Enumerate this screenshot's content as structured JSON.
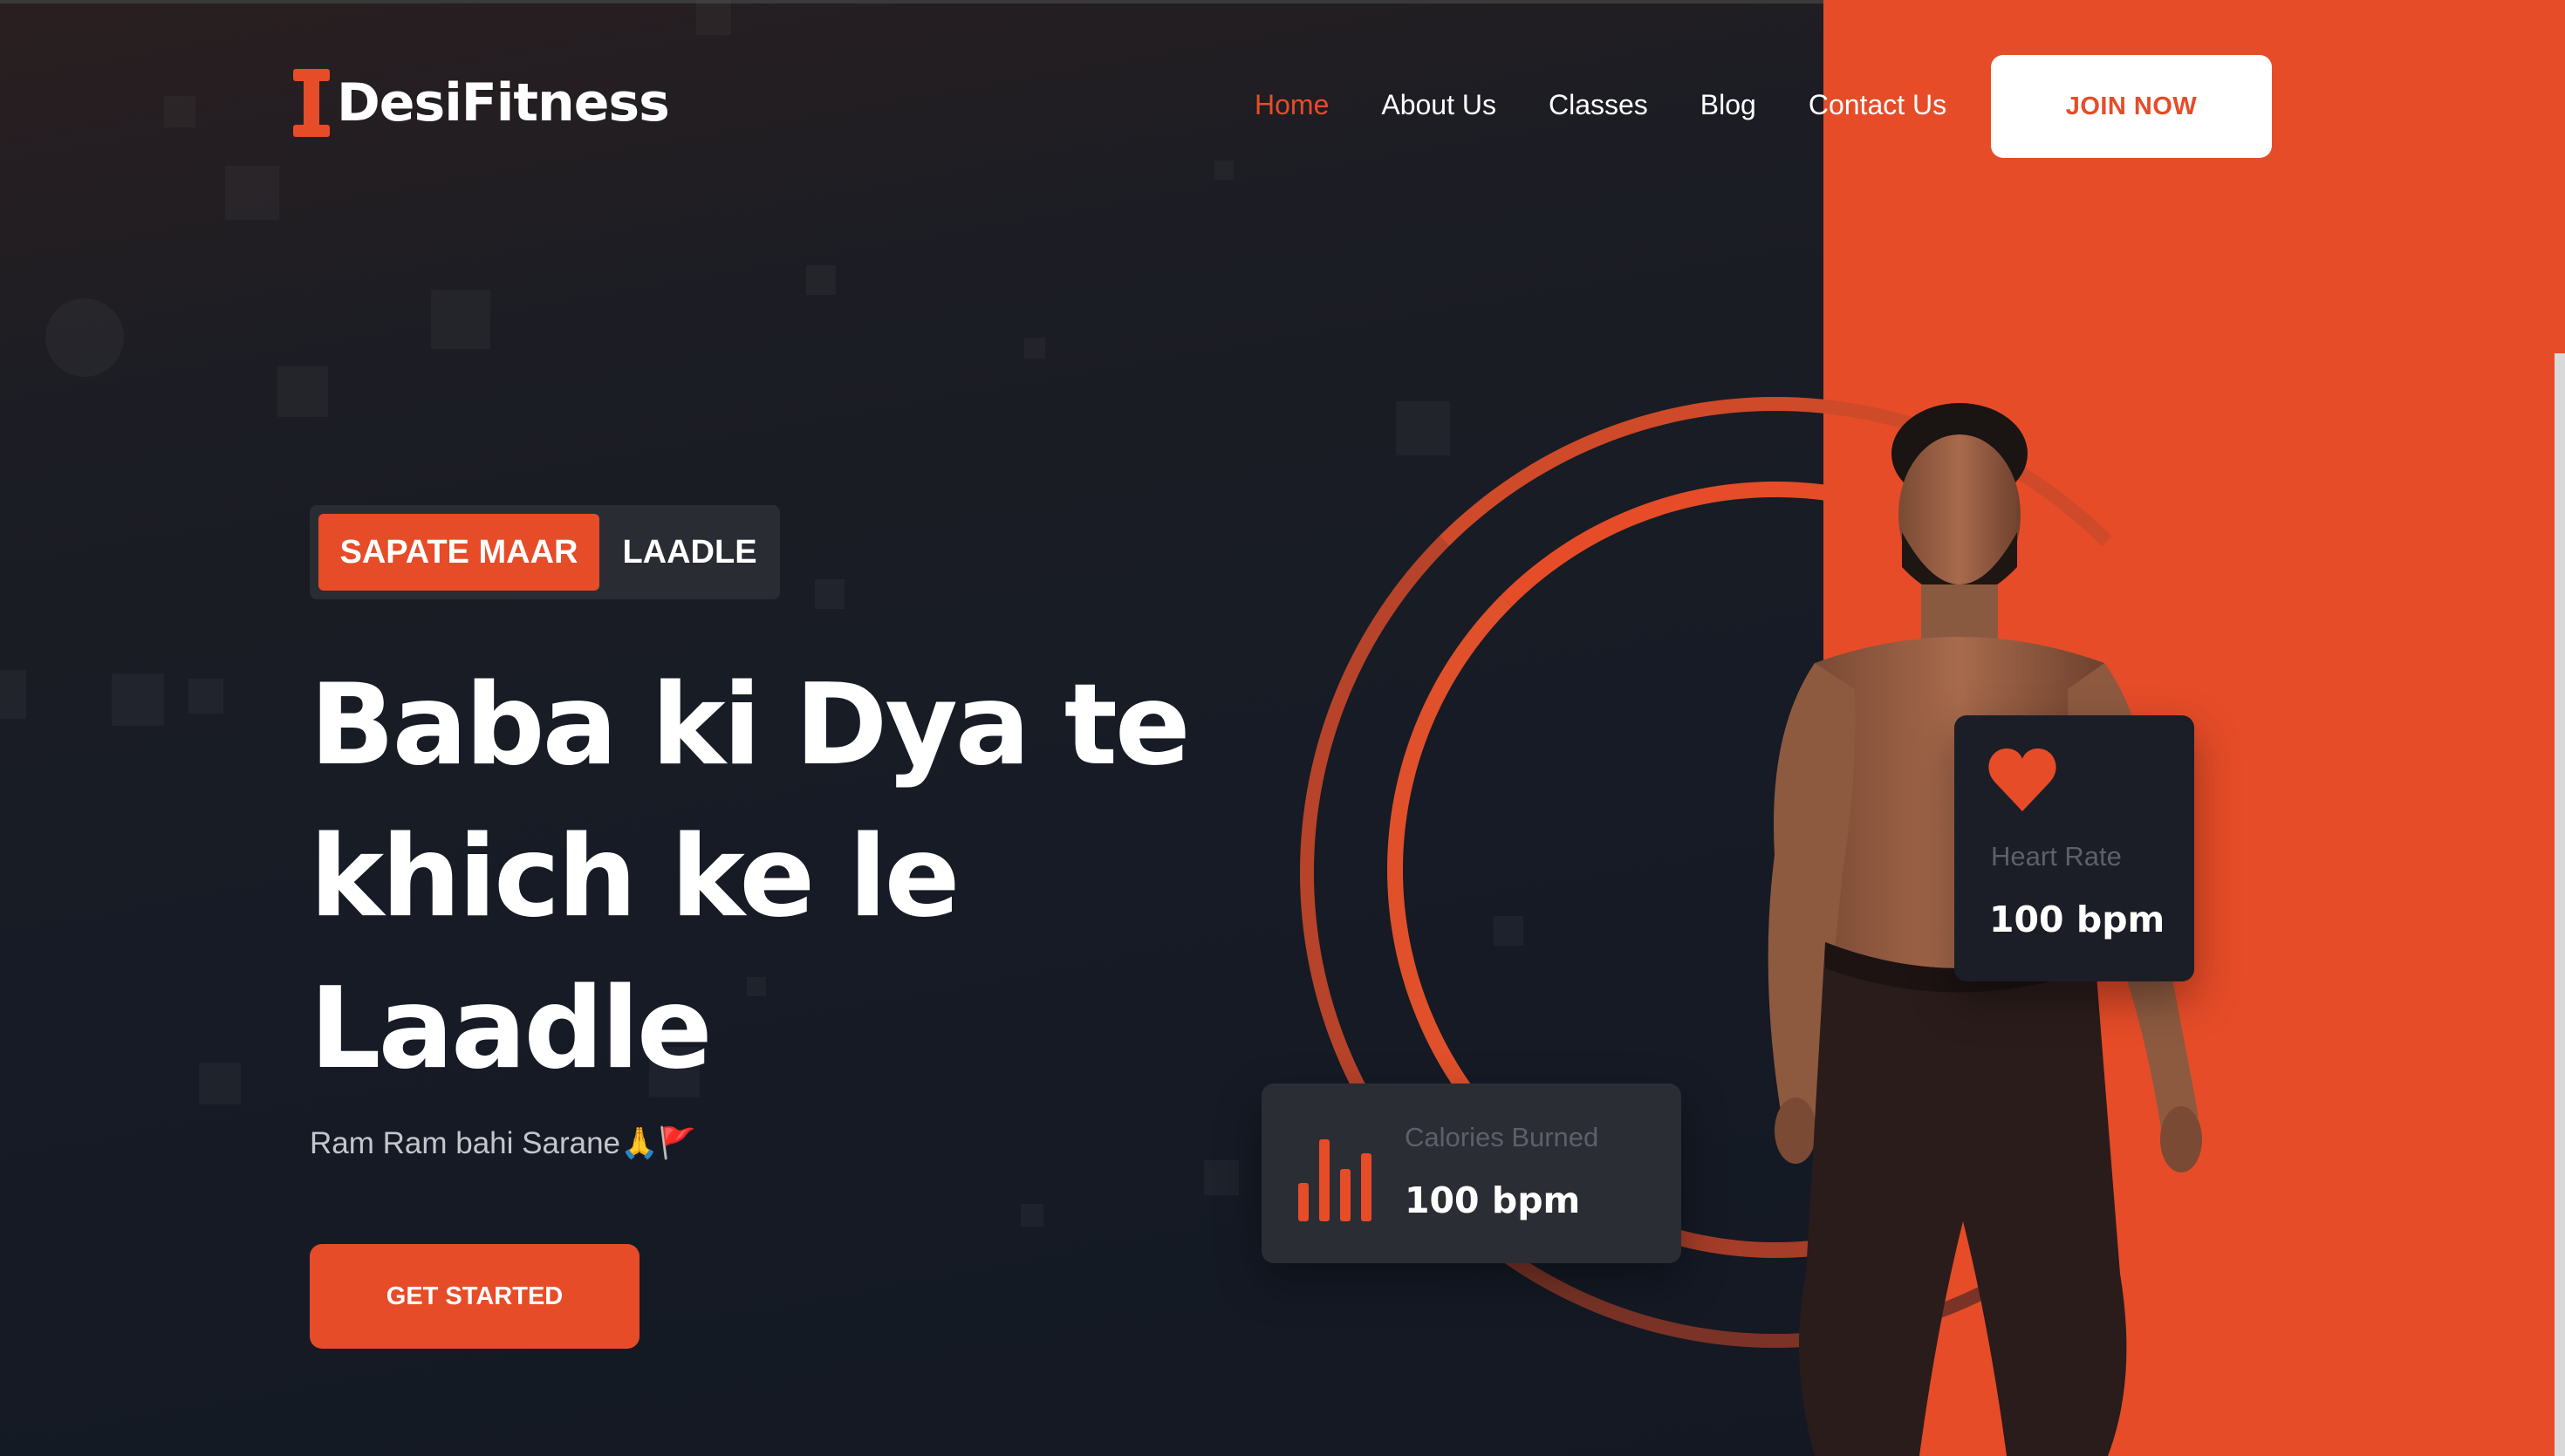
{
  "brand": {
    "name": "DesiFitness",
    "accent": "#e64c28"
  },
  "nav": {
    "items": [
      {
        "label": "Home",
        "active": true
      },
      {
        "label": "About Us",
        "active": false
      },
      {
        "label": "Classes",
        "active": false
      },
      {
        "label": "Blog",
        "active": false
      },
      {
        "label": "Contact Us",
        "active": false
      }
    ],
    "cta": "JOIN NOW"
  },
  "hero": {
    "tag_primary": "SAPATE MAAR",
    "tag_secondary": "LAADLE",
    "title_line1": "Baba ki Dya te",
    "title_line2": "khich ke le",
    "title_line3": "Laadle",
    "subtitle": "Ram Ram bahi Sarane🙏🚩",
    "button": "GET STARTED"
  },
  "stats": {
    "heart": {
      "label": "Heart Rate",
      "value": "100 bpm",
      "icon": "heart-icon"
    },
    "calories": {
      "label": "Calories Burned",
      "value": "100 bpm",
      "icon": "bar-chart-icon"
    }
  },
  "colors": {
    "background": "#161b24",
    "panel": "#e64c28",
    "card": "#1b1e26"
  }
}
